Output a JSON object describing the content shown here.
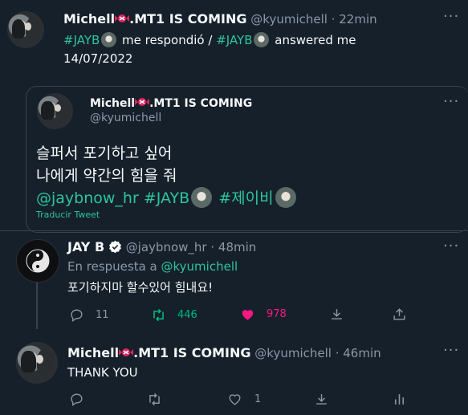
{
  "tweet1": {
    "name": "Michell",
    "name_suffix": ".MT1 IS COMING",
    "handle": "@kyumichell",
    "time": "· 22min",
    "line1_tag1": "#JAYB",
    "line1_text1": " me respondió / ",
    "line1_tag2": "#JAYB",
    "line1_text2": " answered me",
    "line2": "14/07/2022"
  },
  "quoted": {
    "name": "Michell",
    "name_suffix": ".MT1 IS COMING",
    "handle": "@kyumichell",
    "text1": "슬퍼서 포기하고 싶어",
    "text2": "나에게 약간의 힘을 줘",
    "mention": "@jaybnow_hr",
    "tag1": "#JAYB",
    "tag2": "#제이비",
    "translate": "Traducir Tweet"
  },
  "tweet2": {
    "name": "JAY B",
    "handle": "@jaybnow_hr",
    "time": "· 48min",
    "reply_prefix": "En respuesta a ",
    "reply_to": "@kyumichell",
    "text": "포기하지마 할수있어 힘내요!",
    "replies": "11",
    "retweets": "446",
    "likes": "978"
  },
  "tweet3": {
    "name": "Michell",
    "name_suffix": ".MT1 IS COMING",
    "handle": "@kyumichell",
    "time": "· 46min",
    "text": "THANK YOU",
    "likes": "1"
  },
  "colors": {
    "background": "#15202b",
    "accent": "#2ec4a0",
    "retweet": "#00ba7c",
    "like": "#f91880",
    "muted": "#8b98a5"
  }
}
